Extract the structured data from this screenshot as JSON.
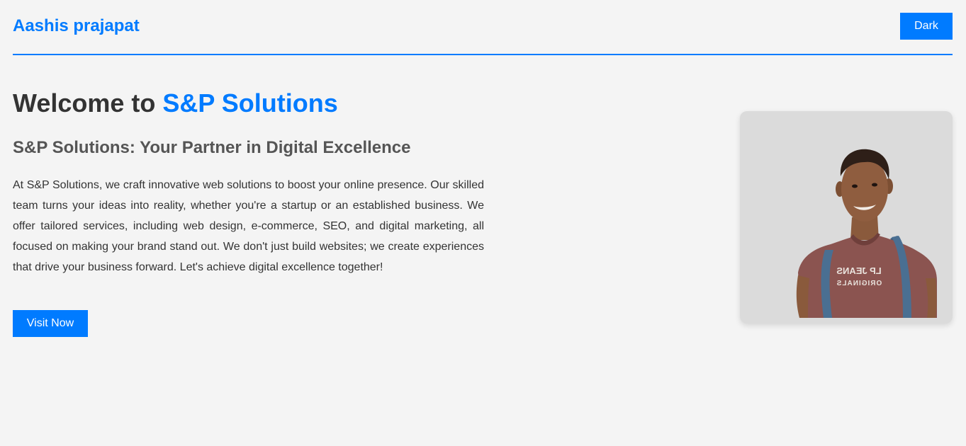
{
  "header": {
    "brand": "Aashis prajapat",
    "theme_toggle_label": "Dark"
  },
  "hero": {
    "welcome_prefix": "Welcome to ",
    "welcome_accent": "S&P Solutions",
    "tagline": "S&P Solutions: Your Partner in Digital Excellence",
    "description": "At S&P Solutions, we craft innovative web solutions to boost your online presence. Our skilled team turns your ideas into reality, whether you're a startup or an established business. We offer tailored services, including web design, e-commerce, SEO, and digital marketing, all focused on making your brand stand out. We don't just build websites; we create experiences that drive your business forward. Let's achieve digital excellence together!",
    "cta_label": "Visit Now"
  },
  "photo": {
    "shirt_text_line1": "LP JEANS",
    "shirt_text_line2": "ORIGINALS"
  },
  "colors": {
    "accent": "#007bff",
    "background": "#f4f4f4",
    "text": "#333333",
    "tagline": "#555555",
    "card": "#dbdbdb"
  }
}
